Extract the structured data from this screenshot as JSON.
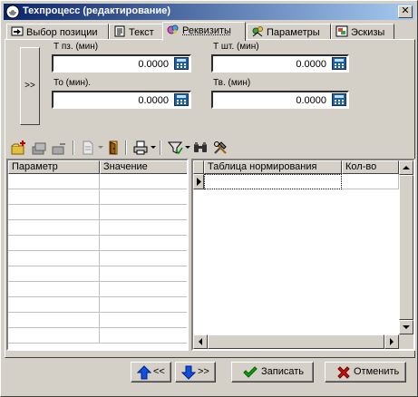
{
  "window": {
    "title": "Техпроцесс (редактирование)",
    "close_glyph": "✕"
  },
  "tabs": [
    {
      "label": "Выбор позиции",
      "icon": "select-position-icon"
    },
    {
      "label": "Текст",
      "icon": "text-doc-icon"
    },
    {
      "label": "Реквизиты",
      "icon": "requisites-icon",
      "active": true
    },
    {
      "label": "Параметры",
      "icon": "parameters-icon"
    },
    {
      "label": "Эскизы",
      "icon": "sketches-icon"
    }
  ],
  "expander": {
    "label": ">>"
  },
  "fields": {
    "t_pz": {
      "label": "Т пз. (мин)",
      "value": "0.0000"
    },
    "t_sht": {
      "label": "Т шт. (мин)",
      "value": "0.0000"
    },
    "t_o": {
      "label": "То (мин).",
      "value": "0.0000"
    },
    "t_v": {
      "label": "Тв. (мин)",
      "value": "0.0000"
    }
  },
  "params_grid": {
    "columns": [
      "Параметр",
      "Значение"
    ],
    "rows": 11
  },
  "norm_grid": {
    "columns": [
      "Таблица нормирования",
      "Кол-во"
    ],
    "rows": 1
  },
  "buttons": {
    "prev": "<<",
    "next": ">>",
    "save": "Записать",
    "cancel": "Отменить"
  },
  "colors": {
    "title_start": "#0a246a",
    "title_end": "#a6caf0",
    "face": "#d4d0c8"
  }
}
